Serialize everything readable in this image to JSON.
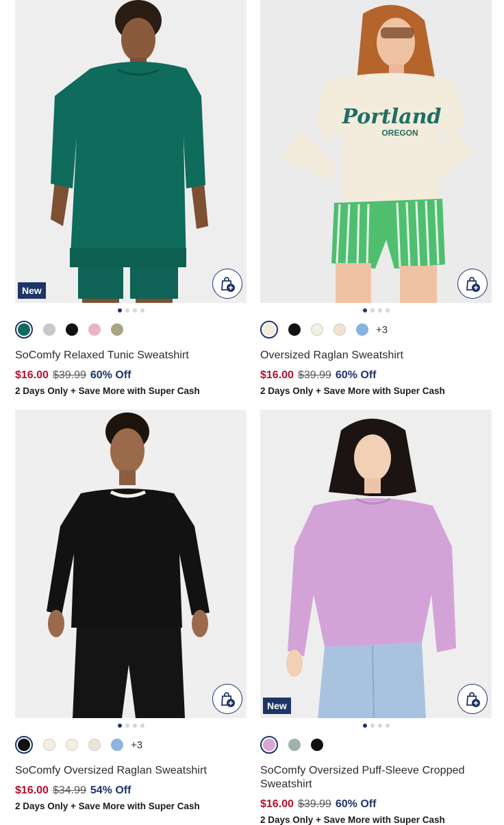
{
  "products": [
    {
      "name": "SoComfy Relaxed Tunic Sweatshirt",
      "badge": "New",
      "sale_price": "$16.00",
      "original_price": "$39.99",
      "discount": "60% Off",
      "promo": "2 Days Only + Save More with Super Cash",
      "image_position": 1,
      "image_count": 4,
      "swatches": [
        "#0f6b5c",
        "#c8c8c8",
        "#111111",
        "#e8b4c6",
        "#a8a585"
      ],
      "more_colors": ""
    },
    {
      "name": "Oversized Raglan Sweatshirt",
      "badge": "",
      "sale_price": "$16.00",
      "original_price": "$39.99",
      "discount": "60% Off",
      "promo": "2 Days Only + Save More with Super Cash",
      "image_position": 1,
      "image_count": 4,
      "swatches": [
        "#f3ebdc",
        "#111111",
        "#f2f0e0",
        "#f1e2d2",
        "#86b3e0"
      ],
      "more_colors": "+3"
    },
    {
      "name": "SoComfy Oversized Raglan Sweatshirt",
      "badge": "",
      "sale_price": "$16.00",
      "original_price": "$34.99",
      "discount": "54% Off",
      "promo": "2 Days Only + Save More with Super Cash",
      "image_position": 1,
      "image_count": 4,
      "swatches": [
        "#111111",
        "#f6ece0",
        "#f4f0e0",
        "#f1e3d4",
        "#8db4dc"
      ],
      "more_colors": "+3"
    },
    {
      "name": "SoComfy Oversized Puff-Sleeve Cropped Sweatshirt",
      "badge": "New",
      "sale_price": "$16.00",
      "original_price": "$39.99",
      "discount": "60% Off",
      "promo": "2 Days Only + Save More with Super Cash",
      "image_position": 1,
      "image_count": 4,
      "swatches": [
        "#d6a6d6",
        "#9fb3aa",
        "#111111"
      ],
      "more_colors": ""
    }
  ],
  "graphics": {
    "p2_print_line1": "Portland",
    "p2_print_line2": "OREGON"
  },
  "colors": {
    "brand_navy": "#1d3466",
    "sale_red": "#b10f2e",
    "photo_bg": "#efefef"
  },
  "icons": {
    "bag": "shopping-bag-plus-icon"
  }
}
